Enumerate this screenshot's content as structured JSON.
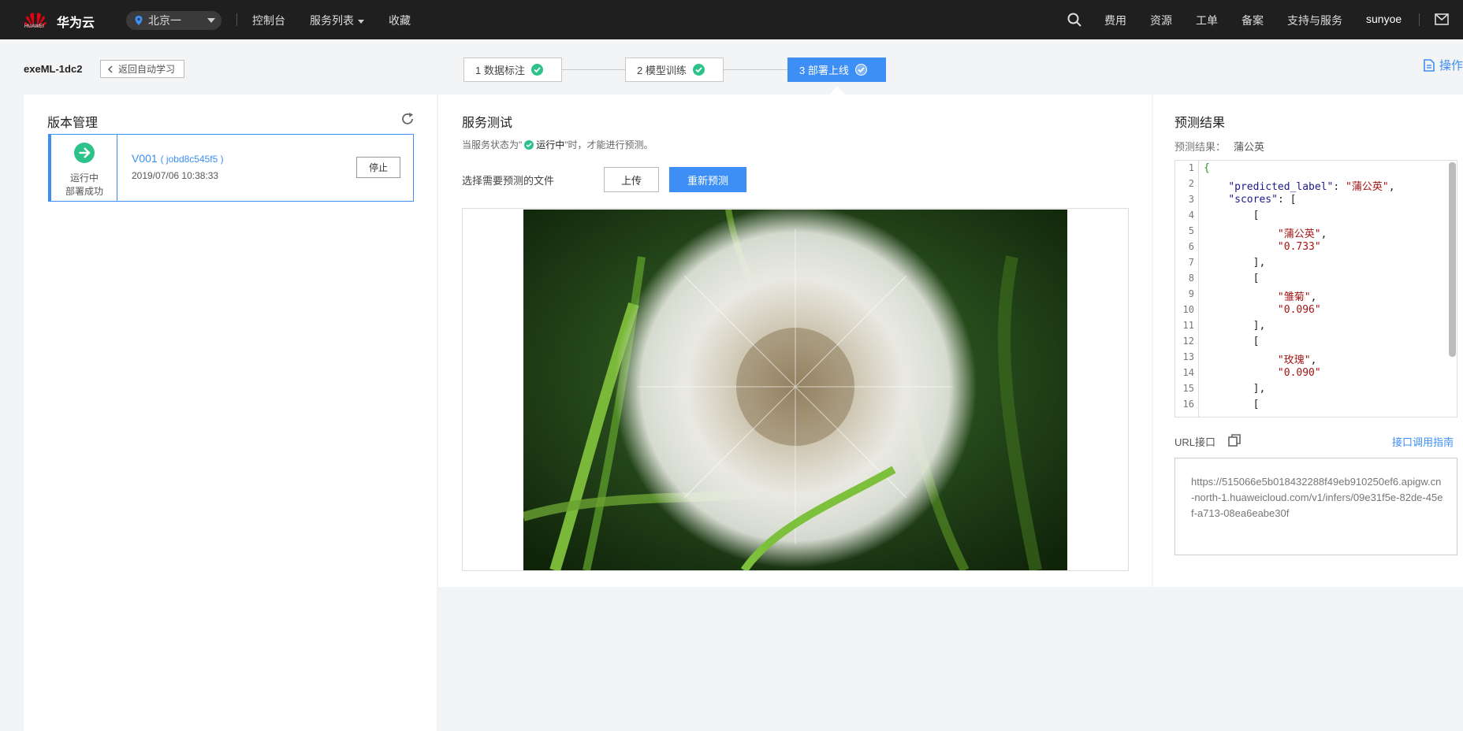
{
  "topnav": {
    "brand": "华为云",
    "brand_sub": "HUAWEI",
    "region": "北京一",
    "links": [
      "控制台",
      "服务列表",
      "收藏"
    ],
    "right_links": [
      "费用",
      "资源",
      "工单",
      "备案",
      "支持与服务"
    ],
    "user": "sunyoe"
  },
  "header": {
    "project_name": "exeML-1dc2",
    "back_label": "返回自动学习",
    "steps": [
      "1 数据标注",
      "2 模型训练",
      "3 部署上线"
    ],
    "operations_label": "操作"
  },
  "version_panel": {
    "title": "版本管理",
    "card": {
      "status_line1": "运行中",
      "status_line2": "部署成功",
      "version": "V001",
      "job_id": "( jobd8c545f5 )",
      "time": "2019/07/06 10:38:33",
      "stop_label": "停止"
    }
  },
  "test_panel": {
    "title": "服务测试",
    "hint_prefix": "当服务状态为\"",
    "hint_status": "运行中",
    "hint_suffix": "\"时，才能进行预测。",
    "choose_label": "选择需要预测的文件",
    "upload_label": "上传",
    "repredict_label": "重新预测"
  },
  "result_panel": {
    "title": "预测结果",
    "result_prefix": "预测结果：",
    "result_value": "蒲公英",
    "code_lines": [
      "{",
      "    \"predicted_label\": \"蒲公英\",",
      "    \"scores\": [",
      "        [",
      "            \"蒲公英\",",
      "            \"0.733\"",
      "        ],",
      "        [",
      "            \"雏菊\",",
      "            \"0.096\"",
      "        ],",
      "        [",
      "            \"玫瑰\",",
      "            \"0.090\"",
      "        ],",
      "        ["
    ],
    "url_label": "URL接口",
    "guide_label": "接口调用指南",
    "url": "https://515066e5b018432288f49eb910250ef6.apigw.cn-north-1.huaweicloud.com/v1/infers/09e31f5e-82de-45ef-a713-08ea6eabe30f"
  },
  "colors": {
    "accent": "#3d8ff5",
    "success": "#2ec28b",
    "nav_bg": "#1f1f1f"
  }
}
